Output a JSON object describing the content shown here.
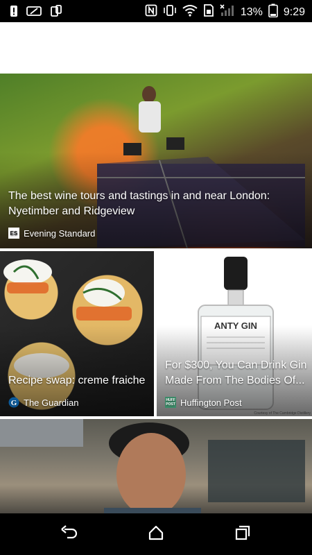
{
  "status_bar": {
    "battery_percent": "13%",
    "time": "9:29",
    "icons": [
      "warning-icon",
      "battery-saver-icon",
      "screen-icon",
      "nfc-icon",
      "vibrate-icon",
      "wifi-icon",
      "sim-icon",
      "signal-icon"
    ]
  },
  "feed": {
    "hero": {
      "title": "The best wine tours and tastings in and near London: Nyetimber and Ridgeview",
      "source": "Evening Standard",
      "source_logo": "ES"
    },
    "card_left": {
      "title": "Recipe swap: creme fraiche",
      "source": "The Guardian",
      "source_logo": "G"
    },
    "card_right": {
      "title": "For $300, You Can Drink Gin Made From The Bodies Of...",
      "source": "Huffington Post",
      "source_logo": "HUFF POST",
      "bottle_label": "ANTY GIN",
      "credit": "Courtesy of The Cambridge Distillery"
    }
  },
  "nav_bar": {
    "icons": [
      "back-icon",
      "home-icon",
      "recents-icon"
    ]
  }
}
